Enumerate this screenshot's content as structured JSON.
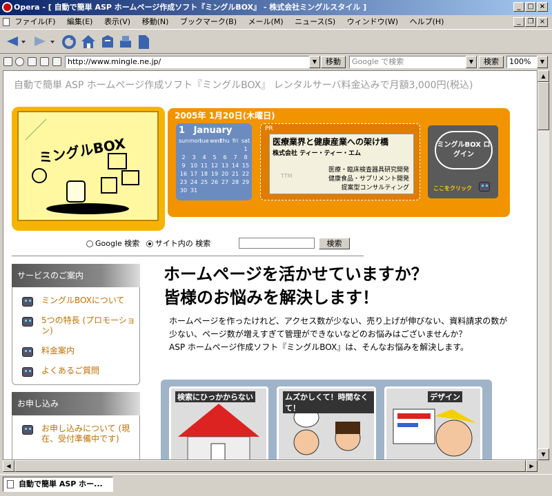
{
  "window": {
    "title": "Opera - [ 自動で簡単 ASP ホームページ作成ソフト『ミングルBOX』 - 株式会社ミングルスタイル ]"
  },
  "menu": [
    "ファイル(F)",
    "編集(E)",
    "表示(V)",
    "移動(N)",
    "ブックマーク(B)",
    "メール(M)",
    "ニュース(S)",
    "ウィンドウ(W)",
    "ヘルプ(H)"
  ],
  "address": {
    "url": "http://www.mingle.ne.jp/",
    "go": "移動",
    "search_placeholder": "Google で検索",
    "search": "検索",
    "zoom": "100%"
  },
  "page": {
    "headline": "自動で簡単 ASP ホームページ作成ソフト『ミングルBOX』 レンタルサーバ料金込みで月額3,000円(税込)",
    "banner": {
      "logo_text": "ミングルBOX",
      "date": "2005年 1月20日(木曜日)",
      "calendar": {
        "day": "1",
        "month": "January",
        "weekdays": [
          "sun",
          "mon",
          "tue",
          "wed",
          "thu",
          "fri",
          "sat"
        ],
        "rows": [
          [
            "",
            "",
            "",
            "",
            "",
            "",
            "1"
          ],
          [
            "2",
            "3",
            "4",
            "5",
            "6",
            "7",
            "8"
          ],
          [
            "9",
            "10",
            "11",
            "12",
            "13",
            "14",
            "15"
          ],
          [
            "16",
            "17",
            "18",
            "19",
            "20",
            "21",
            "22"
          ],
          [
            "23",
            "24",
            "25",
            "26",
            "27",
            "28",
            "29"
          ],
          [
            "30",
            "31",
            "",
            "",
            "",
            "",
            ""
          ]
        ]
      },
      "pr": {
        "label": "PR",
        "title": "医療業界と健康産業への架け橋",
        "company": "株式会社 ティー・ティー・エム",
        "lines": [
          "医療・臨床検査器具研究開発",
          "健康食品・サプリメント開発",
          "提案型コンサルティング"
        ],
        "logo": "TTM"
      },
      "login": {
        "text": "ミングルBOX ログイン",
        "caption": "ここをクリック"
      }
    },
    "search": {
      "option1": "Google 検索",
      "option2": "サイト内の 検索",
      "button": "検索"
    },
    "services": {
      "header": "サービスのご案内",
      "items": [
        "ミングルBOXについて",
        "5つの特長 (プロモーション)",
        "料金案内",
        "よくあるご質問"
      ]
    },
    "apply": {
      "header": "お申し込み",
      "items": [
        "お申し込みについて (現在、受付準備中です)"
      ]
    },
    "main_heading": [
      "ホームページを活かせていますか？",
      "皆様のお悩みを解決します！"
    ],
    "intro": [
      "ホームページを作ったけれど、アクセス数が少ない、売り上げが伸びない、資料請求の数が少ない、ページ数が増えすぎて管理ができないなどのお悩みはございませんか？",
      "ASP ホームページ作成ソフト『ミングルBOX』は、そんなお悩みを解決します。"
    ],
    "cards": [
      "検索にひっかからない",
      "ムズかしくて！時間なくて！",
      "デザイン"
    ]
  },
  "taskbar": {
    "tab": "自動で簡単 ASP ホー..."
  }
}
